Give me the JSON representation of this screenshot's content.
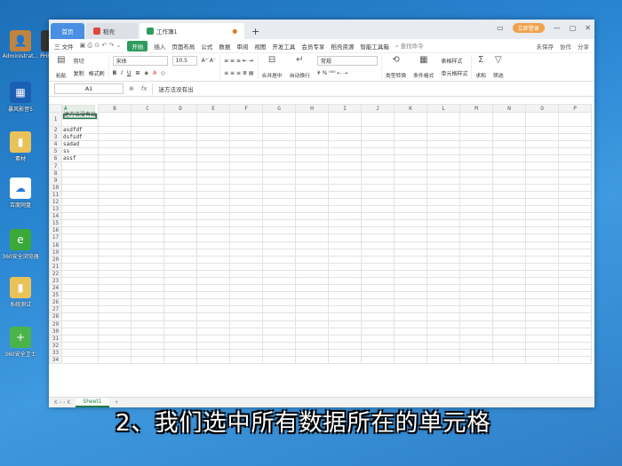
{
  "desktop": {
    "icons": [
      {
        "name": "admin-folder-icon",
        "label": "Administrat...",
        "label2": "PHP",
        "color": "#c0843f",
        "glyph": "👤"
      },
      {
        "name": "baofeng-icon",
        "label": "暴风影音5",
        "color": "#1b5fb4",
        "glyph": "▦"
      },
      {
        "name": "folder-icon",
        "label": "素材",
        "color": "#e9c25a",
        "glyph": "▮"
      },
      {
        "name": "baidu-pan-icon",
        "label": "百度网盘",
        "color": "#ffffff",
        "glyph": "☁"
      },
      {
        "name": "360-browser-icon",
        "label": "360安全浏览器",
        "color": "#3aa93a",
        "glyph": "e"
      },
      {
        "name": "system-folder-icon",
        "label": "系统测试",
        "color": "#e9c25a",
        "glyph": "▮"
      },
      {
        "name": "360-guard-icon",
        "label": "360安全卫士",
        "color": "#4bb34b",
        "glyph": "+"
      }
    ]
  },
  "window": {
    "tabs": [
      {
        "label": "首页"
      },
      {
        "label": "稻壳"
      },
      {
        "label": "工作簿1"
      }
    ],
    "plus": "+",
    "login": "立即登录",
    "menu": {
      "file": "三 文件",
      "start": "开始",
      "items": [
        "插入",
        "页面布局",
        "公式",
        "数据",
        "审阅",
        "视图",
        "开发工具",
        "会员专享",
        "稻壳资源",
        "智能工具箱"
      ],
      "search": "查找命令",
      "right": [
        "未保存",
        "协作",
        "分享"
      ]
    },
    "ribbon": {
      "paste": "粘贴",
      "cut": "剪切",
      "copy": "复制",
      "format_painter": "格式刷",
      "font": "宋体",
      "size": "10.5",
      "merge": "合并居中",
      "wrap": "自动换行",
      "numfmt": "常规",
      "type_convert": "类型转换",
      "cond_format": "条件格式",
      "table_style": "表格样式",
      "cell_style": "单元格样式",
      "sum": "求和",
      "filter": "筛选"
    },
    "formula": {
      "cell": "A1",
      "value": "迷方法没有出"
    },
    "columns": [
      "A",
      "B",
      "C",
      "D",
      "E",
      "F",
      "G",
      "H",
      "I",
      "J",
      "K",
      "L",
      "M",
      "N",
      "O",
      "P"
    ],
    "cells": {
      "A1": "迷方法没有出",
      "A2": "asdfdf",
      "A3": "dsfsdf",
      "A4": "sadad",
      "A5": "ss",
      "A6": "assf"
    },
    "sheet": "Sheet1"
  },
  "caption": "2、我们选中所有数据所在的单元格"
}
